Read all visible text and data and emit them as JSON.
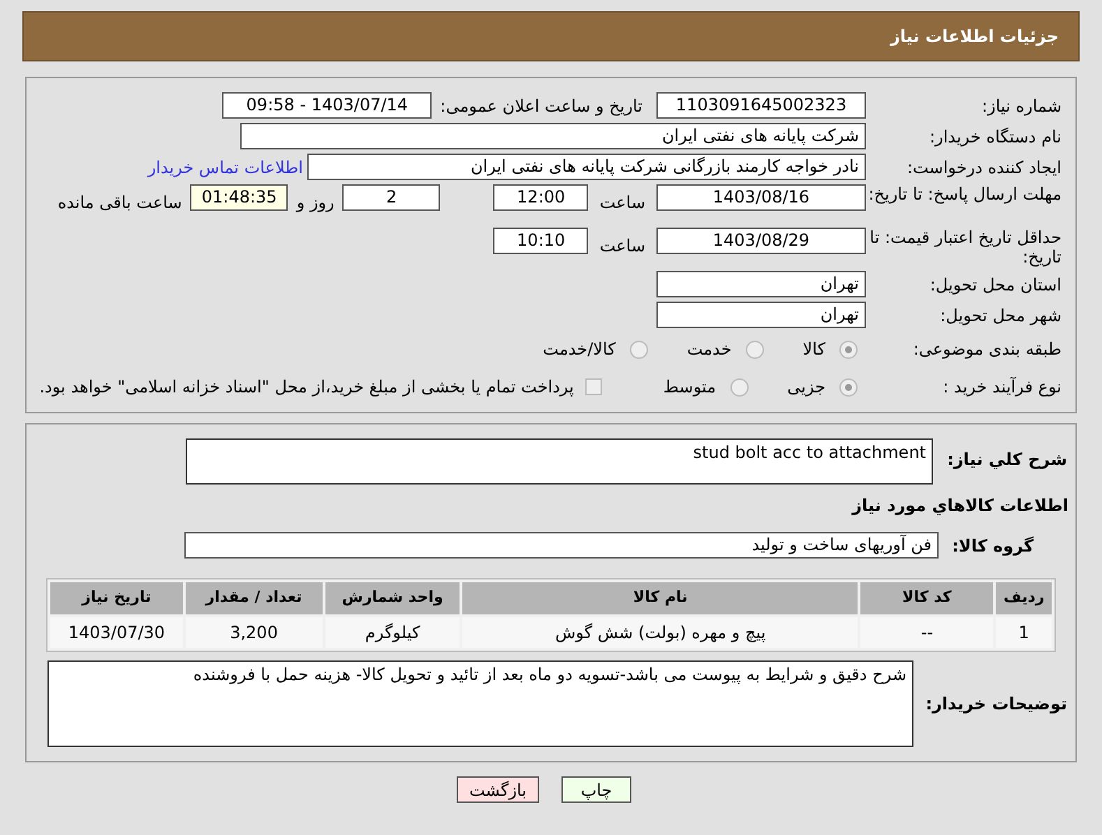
{
  "header": {
    "title": "جزئیات اطلاعات نیاز"
  },
  "need_number": {
    "label": "شماره نیاز:",
    "value": "1103091645002323"
  },
  "announce": {
    "label": "تاریخ و ساعت اعلان عمومی:",
    "value": "1403/07/14 - 09:58"
  },
  "buyer": {
    "label": "نام دستگاه خریدار:",
    "value": "شرکت پایانه های نفتی ایران"
  },
  "requester": {
    "label": "ایجاد کننده درخواست:",
    "value": "نادر خواجه کارمند بازرگانی شرکت پایانه های نفتی ایران",
    "link": "اطلاعات تماس خریدار"
  },
  "deadline": {
    "label": "مهلت ارسال پاسخ: تا تاریخ:",
    "date": "1403/08/16",
    "time_label": "ساعت",
    "time": "12:00",
    "days": "2",
    "days_label": "روز و",
    "remaining": "01:48:35",
    "remaining_label": "ساعت باقی مانده"
  },
  "validity": {
    "label": "حداقل تاریخ اعتبار قیمت: تا تاریخ:",
    "date": "1403/08/29",
    "time_label": "ساعت",
    "time": "10:10"
  },
  "province": {
    "label": "استان محل تحویل:",
    "value": "تهران"
  },
  "city": {
    "label": "شهر محل تحویل:",
    "value": "تهران"
  },
  "category": {
    "label": "طبقه بندی موضوعی:",
    "options": [
      {
        "label": "کالا",
        "selected": true
      },
      {
        "label": "خدمت",
        "selected": false
      },
      {
        "label": "کالا/خدمت",
        "selected": false
      }
    ]
  },
  "process": {
    "label": "نوع فرآیند خرید :",
    "options": [
      {
        "label": "جزیی",
        "selected": true
      },
      {
        "label": "متوسط",
        "selected": false
      }
    ],
    "treasury": {
      "checked": false,
      "label": "پرداخت تمام یا بخشی از مبلغ خرید،از محل \"اسناد خزانه اسلامی\" خواهد بود."
    }
  },
  "summary": {
    "label": "شرح کلي نياز:",
    "value": "stud bolt acc to attachment"
  },
  "goods_heading": "اطلاعات كالاهاي مورد نياز",
  "goods_group": {
    "label": "گروه کالا:",
    "value": "فن آوریهای ساخت و تولید"
  },
  "table": {
    "columns": [
      "ردیف",
      "کد کالا",
      "نام کالا",
      "واحد شمارش",
      "تعداد / مقدار",
      "تاریخ نیاز"
    ],
    "rows": [
      [
        "1",
        "--",
        "پیچ و مهره (بولت) شش گوش",
        "کیلوگرم",
        "3,200",
        "1403/07/30"
      ]
    ]
  },
  "buyer_notes": {
    "label": "توضیحات خریدار:",
    "value": "شرح دقیق و شرایط به پیوست می باشد-تسویه دو ماه بعد از تائید و تحویل کالا- هزینه حمل با فروشنده"
  },
  "buttons": [
    {
      "kind": "print",
      "label": "چاپ"
    },
    {
      "kind": "back",
      "label": "بازگشت"
    }
  ]
}
